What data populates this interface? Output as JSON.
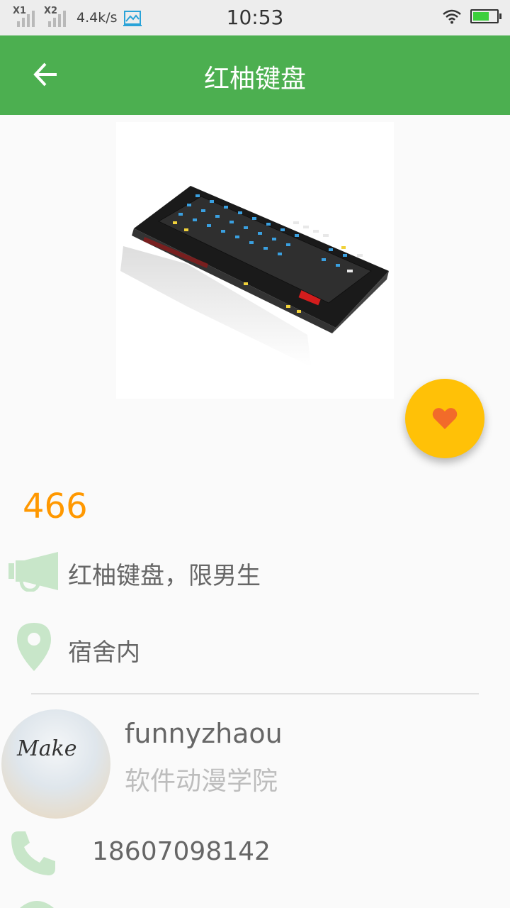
{
  "status_bar": {
    "sim1": "X1",
    "sim2": "X2",
    "speed": "4.4k/s",
    "time": "10:53"
  },
  "app_bar": {
    "title": "红柚键盘"
  },
  "product": {
    "price": "466",
    "description": "红柚键盘，限男生",
    "location": "宿舍内"
  },
  "seller": {
    "username": "funnyzhaou",
    "school": "软件动漫学院",
    "phone": "18607098142"
  },
  "icons": {
    "back": "arrow-back-icon",
    "favorite": "heart-icon",
    "announce": "megaphone-icon",
    "location": "location-pin-icon",
    "phone": "phone-icon",
    "wifi": "wifi-icon",
    "battery": "battery-icon",
    "gallery": "gallery-icon"
  },
  "colors": {
    "primary": "#4caf50",
    "accent": "#ffc107",
    "price": "#ff9800",
    "heart": "#f26b2a",
    "icon_tint": "#c8e6c9"
  }
}
